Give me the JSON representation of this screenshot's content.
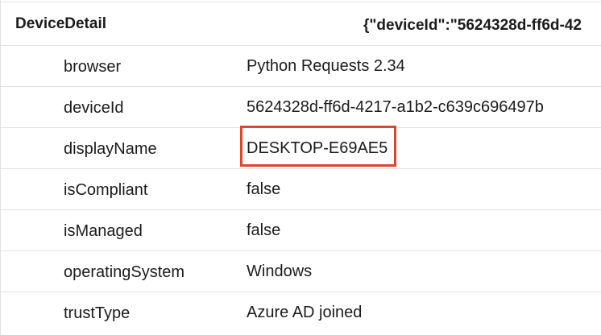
{
  "header": {
    "key": "DeviceDetail",
    "value": "{\"deviceId\":\"5624328d-ff6d-42"
  },
  "rows": [
    {
      "key": "browser",
      "value": "Python Requests 2.34"
    },
    {
      "key": "deviceId",
      "value": "5624328d-ff6d-4217-a1b2-c639c696497b"
    },
    {
      "key": "displayName",
      "value": "DESKTOP-E69AE5"
    },
    {
      "key": "isCompliant",
      "value": "false"
    },
    {
      "key": "isManaged",
      "value": "false"
    },
    {
      "key": "operatingSystem",
      "value": "Windows"
    },
    {
      "key": "trustType",
      "value": "Azure AD joined"
    }
  ],
  "highlight": {
    "color": "#d9472e",
    "row": "displayName"
  }
}
